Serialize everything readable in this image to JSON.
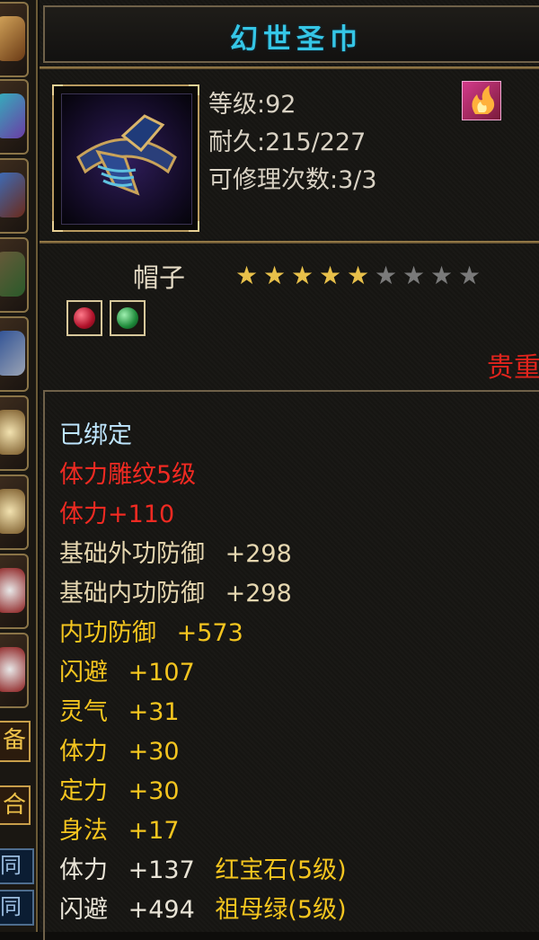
{
  "item": {
    "name": "幻世圣巾",
    "level_text": "等级:92",
    "durability_text": "耐久:215/227",
    "repair_text": "可修理次数:3/3",
    "type": "帽子",
    "stars_filled": 5,
    "stars_total": 9,
    "precious_label": "贵重",
    "sockets": [
      "ruby-gem",
      "emerald-gem"
    ]
  },
  "attributes": {
    "bound": "已绑定",
    "engrave": "体力雕纹5级",
    "engrave_bonus": "体力+110",
    "base_ext_def": "基础外功防御",
    "base_ext_def_val": "+298",
    "base_int_def": "基础内功防御",
    "base_int_def_val": "+298",
    "int_def": "内功防御",
    "int_def_val": "+573",
    "dodge": "闪避",
    "dodge_val": "+107",
    "spirit": "灵气",
    "spirit_val": "+31",
    "stamina": "体力",
    "stamina_val": "+30",
    "focus": "定力",
    "focus_val": "+30",
    "agility": "身法",
    "agility_val": "+17",
    "gem1_stat": "体力",
    "gem1_val": "+137",
    "gem1_name": "红宝石(5级)",
    "gem2_stat": "闪避",
    "gem2_val": "+494",
    "gem2_name": "祖母绿(5级)"
  },
  "side": {
    "tab_char": "备",
    "tab2_char": "合",
    "link1": "同",
    "link2": "同"
  },
  "colors": {
    "title": "#35c6e6",
    "red": "#f02a22",
    "yellow": "#f4c51f",
    "star_filled": "#e8c04a",
    "star_empty": "#7a7a7a"
  }
}
